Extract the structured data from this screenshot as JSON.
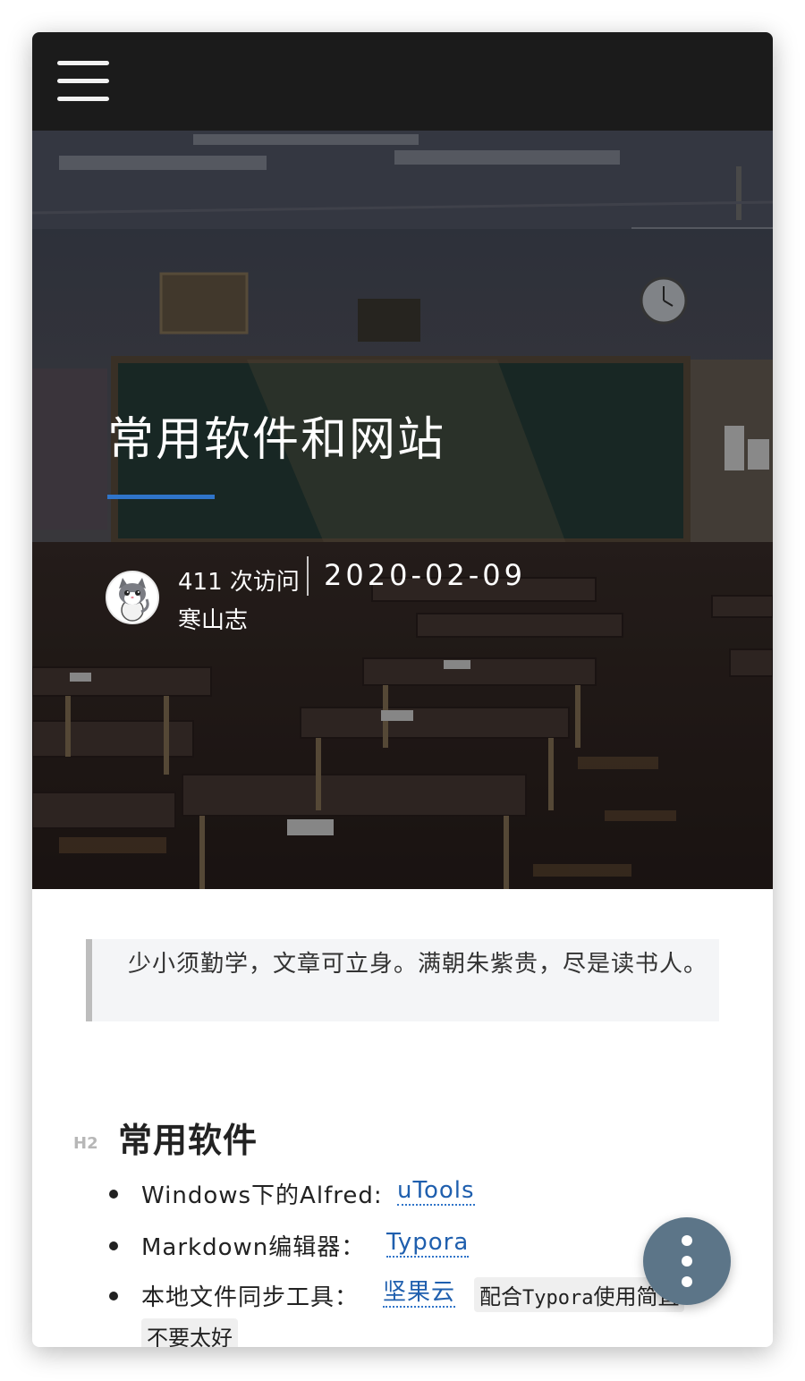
{
  "header": {
    "menu_icon": "hamburger-menu-icon"
  },
  "post": {
    "title": "常用软件和网站",
    "visits": "411 次访问",
    "date": "2020-02-09",
    "author": "寒山志",
    "avatar_icon": "cat-avatar-icon",
    "accent_color": "#2f74c9"
  },
  "article": {
    "quote": "少小须勤学，文章可立身。满朝朱紫贵，尽是读书人。",
    "section": {
      "badge": "H2",
      "title": "常用软件"
    },
    "items": [
      {
        "text": "Windows下的Alfred: ",
        "link": "uTools"
      },
      {
        "text": "Markdown编辑器：",
        "link": "Typora"
      },
      {
        "text": "本地文件同步工具：",
        "link": "坚果云",
        "note_prefix": "配合",
        "note_code": "Typora",
        "note_suffix": "使用简直",
        "note_line2": "不要太好"
      }
    ]
  },
  "fab": {
    "icon": "more-vertical-icon",
    "color": "#5c7588"
  }
}
